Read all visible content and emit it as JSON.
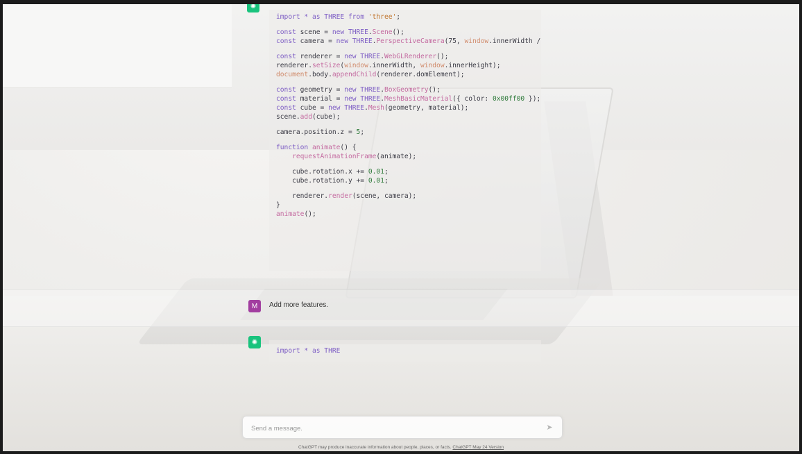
{
  "conversation": {
    "assistant_code_lines": [
      [
        {
          "t": "import * as THREE ",
          "c": "kw"
        },
        {
          "t": "from ",
          "c": "kw"
        },
        {
          "t": "'three'",
          "c": "str"
        },
        {
          "t": ";",
          "c": ""
        }
      ],
      [],
      [
        {
          "t": "const ",
          "c": "kw"
        },
        {
          "t": "scene = ",
          "c": ""
        },
        {
          "t": "new THREE",
          "c": "kw"
        },
        {
          "t": ".",
          "c": ""
        },
        {
          "t": "Scene",
          "c": "fn"
        },
        {
          "t": "();",
          "c": ""
        }
      ],
      [
        {
          "t": "const ",
          "c": "kw"
        },
        {
          "t": "camera = ",
          "c": ""
        },
        {
          "t": "new THREE",
          "c": "kw"
        },
        {
          "t": ".",
          "c": ""
        },
        {
          "t": "PerspectiveCamera",
          "c": "fn"
        },
        {
          "t": "(75, ",
          "c": ""
        },
        {
          "t": "window",
          "c": "glob"
        },
        {
          "t": ".innerWidth /",
          "c": ""
        }
      ],
      [],
      [
        {
          "t": "const ",
          "c": "kw"
        },
        {
          "t": "renderer = ",
          "c": ""
        },
        {
          "t": "new THREE",
          "c": "kw"
        },
        {
          "t": ".",
          "c": ""
        },
        {
          "t": "WebGLRenderer",
          "c": "fn"
        },
        {
          "t": "();",
          "c": ""
        }
      ],
      [
        {
          "t": "renderer.",
          "c": ""
        },
        {
          "t": "setSize",
          "c": "fn"
        },
        {
          "t": "(",
          "c": ""
        },
        {
          "t": "window",
          "c": "glob"
        },
        {
          "t": ".innerWidth, ",
          "c": ""
        },
        {
          "t": "window",
          "c": "glob"
        },
        {
          "t": ".innerHeight);",
          "c": ""
        }
      ],
      [
        {
          "t": "document",
          "c": "glob"
        },
        {
          "t": ".body.",
          "c": ""
        },
        {
          "t": "appendChild",
          "c": "fn"
        },
        {
          "t": "(renderer.domElement);",
          "c": ""
        }
      ],
      [],
      [
        {
          "t": "const ",
          "c": "kw"
        },
        {
          "t": "geometry = ",
          "c": ""
        },
        {
          "t": "new THREE",
          "c": "kw"
        },
        {
          "t": ".",
          "c": ""
        },
        {
          "t": "BoxGeometry",
          "c": "fn"
        },
        {
          "t": "();",
          "c": ""
        }
      ],
      [
        {
          "t": "const ",
          "c": "kw"
        },
        {
          "t": "material = ",
          "c": ""
        },
        {
          "t": "new THREE",
          "c": "kw"
        },
        {
          "t": ".",
          "c": ""
        },
        {
          "t": "MeshBasicMaterial",
          "c": "fn"
        },
        {
          "t": "({ color: ",
          "c": ""
        },
        {
          "t": "0x00ff00",
          "c": "num"
        },
        {
          "t": " });",
          "c": ""
        }
      ],
      [
        {
          "t": "const ",
          "c": "kw"
        },
        {
          "t": "cube = ",
          "c": ""
        },
        {
          "t": "new THREE",
          "c": "kw"
        },
        {
          "t": ".",
          "c": ""
        },
        {
          "t": "Mesh",
          "c": "fn"
        },
        {
          "t": "(geometry, material);",
          "c": ""
        }
      ],
      [
        {
          "t": "scene.",
          "c": ""
        },
        {
          "t": "add",
          "c": "fn"
        },
        {
          "t": "(cube);",
          "c": ""
        }
      ],
      [],
      [
        {
          "t": "camera.position.z = ",
          "c": ""
        },
        {
          "t": "5",
          "c": "num"
        },
        {
          "t": ";",
          "c": ""
        }
      ],
      [],
      [
        {
          "t": "function ",
          "c": "kw"
        },
        {
          "t": "animate",
          "c": "fn"
        },
        {
          "t": "() {",
          "c": ""
        }
      ],
      [
        {
          "t": "    ",
          "c": ""
        },
        {
          "t": "requestAnimationFrame",
          "c": "fn"
        },
        {
          "t": "(animate);",
          "c": ""
        }
      ],
      [],
      [
        {
          "t": "    cube.rotation.x += ",
          "c": ""
        },
        {
          "t": "0.01",
          "c": "num"
        },
        {
          "t": ";",
          "c": ""
        }
      ],
      [
        {
          "t": "    cube.rotation.y += ",
          "c": ""
        },
        {
          "t": "0.01",
          "c": "num"
        },
        {
          "t": ";",
          "c": ""
        }
      ],
      [],
      [
        {
          "t": "    renderer.",
          "c": ""
        },
        {
          "t": "render",
          "c": "fn"
        },
        {
          "t": "(scene, camera);",
          "c": ""
        }
      ],
      [
        {
          "t": "}",
          "c": ""
        }
      ],
      [
        {
          "t": "animate",
          "c": "fn"
        },
        {
          "t": "();",
          "c": ""
        }
      ]
    ],
    "user_message": "Add more features.",
    "user_avatar_letter": "M",
    "assistant_partial_code": [
      [
        {
          "t": "import * as THRE",
          "c": "kw"
        }
      ]
    ]
  },
  "composer": {
    "placeholder": "Send a message.",
    "send_icon": "paper-plane-icon"
  },
  "footer": {
    "disclaimer": "ChatGPT may produce inaccurate information about people, places, or facts. ",
    "version_link": "ChatGPT May 24 Version"
  },
  "colors": {
    "assistant_avatar": "#19c37d",
    "user_avatar": "#a23ea0"
  }
}
